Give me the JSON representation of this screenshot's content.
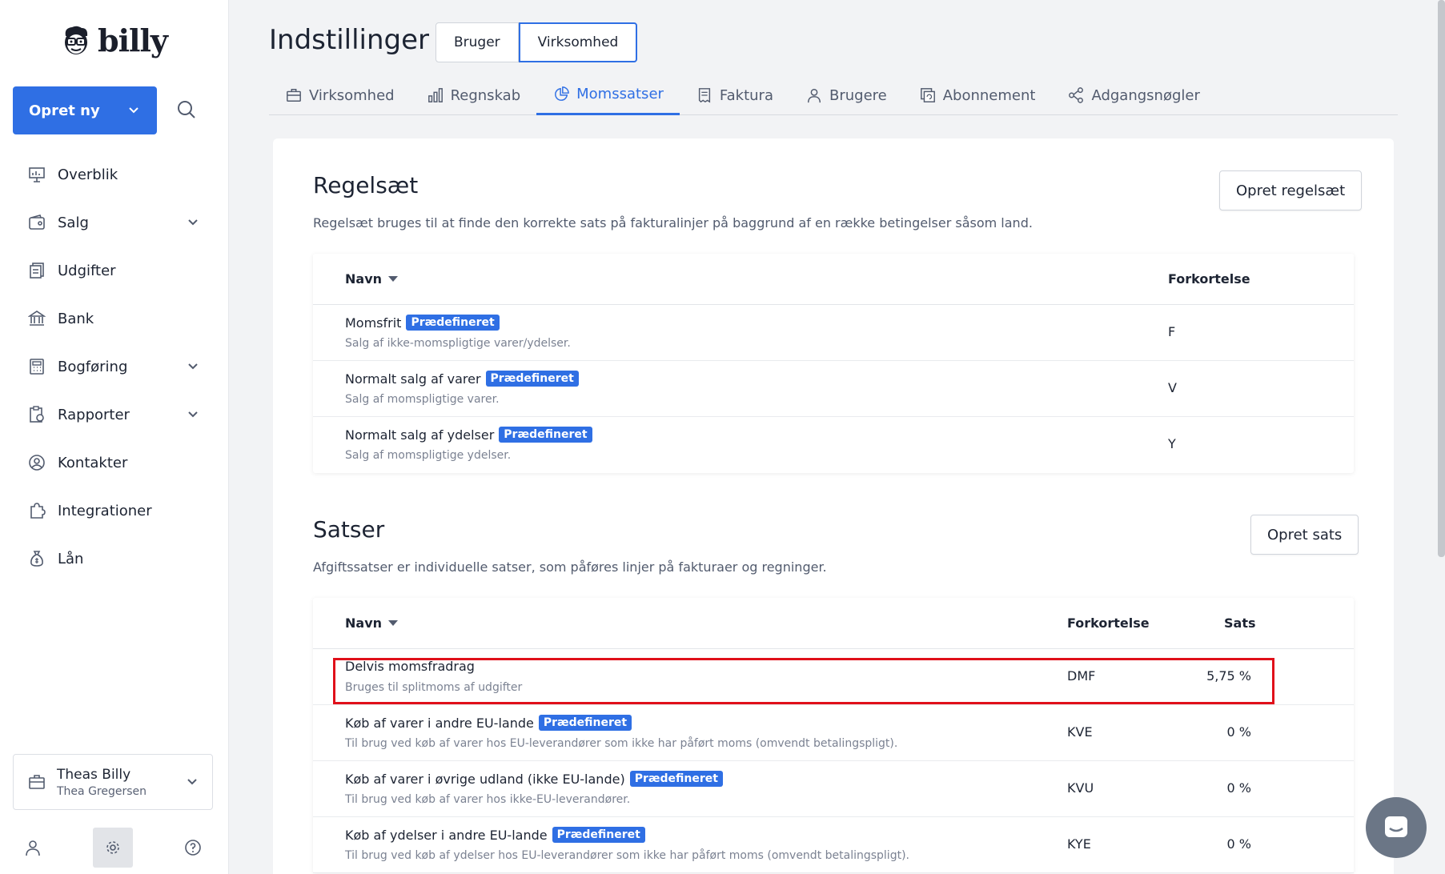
{
  "app": {
    "logo_text": "billy"
  },
  "sidebar": {
    "create_label": "Opret ny",
    "items": [
      {
        "label": "Overblik",
        "icon": "presentation-icon",
        "expandable": false
      },
      {
        "label": "Salg",
        "icon": "wallet-icon",
        "expandable": true
      },
      {
        "label": "Udgifter",
        "icon": "receipts-icon",
        "expandable": false
      },
      {
        "label": "Bank",
        "icon": "bank-icon",
        "expandable": false
      },
      {
        "label": "Bogføring",
        "icon": "calculator-icon",
        "expandable": true
      },
      {
        "label": "Rapporter",
        "icon": "report-icon",
        "expandable": true
      },
      {
        "label": "Kontakter",
        "icon": "contact-icon",
        "expandable": false
      },
      {
        "label": "Integrationer",
        "icon": "puzzle-icon",
        "expandable": false
      },
      {
        "label": "Lån",
        "icon": "moneybag-icon",
        "expandable": false
      }
    ],
    "org": {
      "name": "Theas Billy",
      "user": "Thea Gregersen"
    }
  },
  "header": {
    "title": "Indstillinger",
    "segments": [
      "Bruger",
      "Virksomhed"
    ],
    "active_segment": "Virksomhed"
  },
  "tabs": [
    {
      "label": "Virksomhed",
      "icon": "briefcase-icon"
    },
    {
      "label": "Regnskab",
      "icon": "bar-chart-icon"
    },
    {
      "label": "Momssatser",
      "icon": "pie-chart-icon",
      "active": true
    },
    {
      "label": "Faktura",
      "icon": "invoice-icon"
    },
    {
      "label": "Brugere",
      "icon": "user-icon"
    },
    {
      "label": "Abonnement",
      "icon": "subscription-icon"
    },
    {
      "label": "Adgangsnøgler",
      "icon": "share-icon"
    }
  ],
  "rulesets": {
    "title": "Regelsæt",
    "description": "Regelsæt bruges til at finde den korrekte sats på fakturalinjer på baggrund af en række betingelser såsom land.",
    "create_label": "Opret regelsæt",
    "columns": {
      "name": "Navn",
      "abbr": "Forkortelse"
    },
    "rows": [
      {
        "name": "Momsfrit",
        "badge": "Prædefineret",
        "desc": "Salg af ikke-momspligtige varer/ydelser.",
        "abbr": "F"
      },
      {
        "name": "Normalt salg af varer",
        "badge": "Prædefineret",
        "desc": "Salg af momspligtige varer.",
        "abbr": "V"
      },
      {
        "name": "Normalt salg af ydelser",
        "badge": "Prædefineret",
        "desc": "Salg af momspligtige ydelser.",
        "abbr": "Y"
      }
    ]
  },
  "rates": {
    "title": "Satser",
    "description": "Afgiftssatser er individuelle satser, som påføres linjer på fakturaer og regninger.",
    "create_label": "Opret sats",
    "columns": {
      "name": "Navn",
      "abbr": "Forkortelse",
      "rate": "Sats"
    },
    "rows": [
      {
        "name": "Delvis momsfradrag",
        "badge": "",
        "desc": "Bruges til splitmoms af udgifter",
        "abbr": "DMF",
        "rate": "5,75 %"
      },
      {
        "name": "Køb af varer i andre EU-lande",
        "badge": "Prædefineret",
        "desc": "Til brug ved køb af varer hos EU-leverandører som ikke har påført moms (omvendt betalingspligt).",
        "abbr": "KVE",
        "rate": "0 %"
      },
      {
        "name": "Køb af varer i øvrige udland (ikke EU-lande)",
        "badge": "Prædefineret",
        "desc": "Til brug ved køb af varer hos ikke-EU-leverandører.",
        "abbr": "KVU",
        "rate": "0 %"
      },
      {
        "name": "Køb af ydelser i andre EU-lande",
        "badge": "Prædefineret",
        "desc": "Til brug ved køb af ydelser hos EU-leverandører som ikke har påført moms (omvendt betalingspligt).",
        "abbr": "KYE",
        "rate": "0 %"
      }
    ]
  },
  "colors": {
    "accent": "#2f6fe4",
    "highlight": "#e0101a"
  }
}
